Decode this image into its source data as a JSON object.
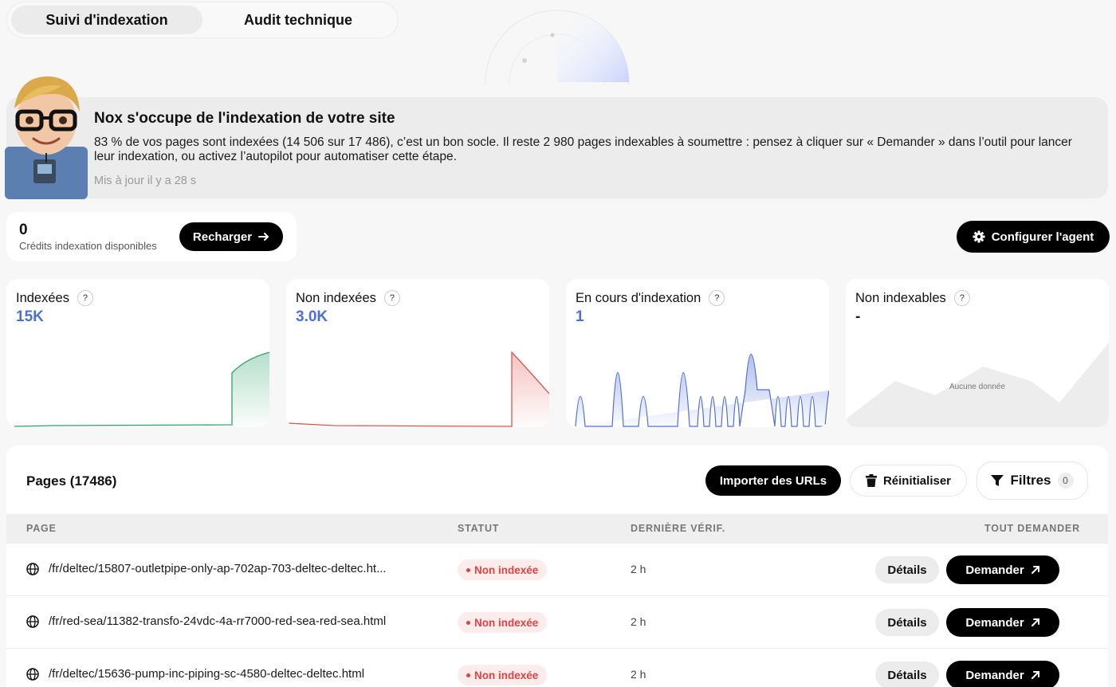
{
  "tabs": [
    {
      "label": "Suivi d'indexation",
      "active": true
    },
    {
      "label": "Audit technique",
      "active": false
    }
  ],
  "banner": {
    "title": "Nox s'occupe de l'indexation de votre site",
    "text": "83 % de vos pages sont indexées (14 506 sur 17 486), c’est un bon socle. Il reste 2 980 pages indexables à soumettre : pensez à cliquer sur « Demander » dans l’outil pour lancer leur indexation, ou activez l’autopilot pour automatiser cette étape.",
    "updated": "Mis à jour il y a 28 s"
  },
  "credits": {
    "value": "0",
    "label": "Crédits indexation disponibles",
    "recharge_label": "Recharger"
  },
  "configure_label": "Configurer l'agent",
  "stats": [
    {
      "title": "Indexées",
      "help": "?",
      "value": "15K",
      "color": "#2ea36a"
    },
    {
      "title": "Non indexées",
      "help": "?",
      "value": "3.0K",
      "color": "#e0554f"
    },
    {
      "title": "En cours d'indexation",
      "help": "?",
      "value": "1",
      "color": "#4e6fd4"
    },
    {
      "title": "Non indexables",
      "help": "?",
      "value": "-",
      "empty_label": "Aucune donnée"
    }
  ],
  "table": {
    "title": "Pages (17486)",
    "import_label": "Importer des URLs",
    "reset_label": "Réinitialiser",
    "filters_label": "Filtres",
    "filters_count": "0",
    "columns": {
      "page": "PAGE",
      "status": "STATUT",
      "last_check": "DERNIÈRE VÉRIF.",
      "request_all": "TOUT DEMANDER"
    },
    "rows": [
      {
        "url": "/fr/deltec/15807-outletpipe-only-ap-702ap-703-deltec-deltec.ht...",
        "status": "Non indexée",
        "last_check": "2 h",
        "details": "Détails",
        "request": "Demander"
      },
      {
        "url": "/fr/red-sea/11382-transfo-24vdc-4a-rr7000-red-sea-red-sea.html",
        "status": "Non indexée",
        "last_check": "2 h",
        "details": "Détails",
        "request": "Demander"
      },
      {
        "url": "/fr/deltec/15636-pump-inc-piping-sc-4580-deltec-deltec.html",
        "status": "Non indexée",
        "last_check": "2 h",
        "details": "Détails",
        "request": "Demander"
      }
    ]
  }
}
